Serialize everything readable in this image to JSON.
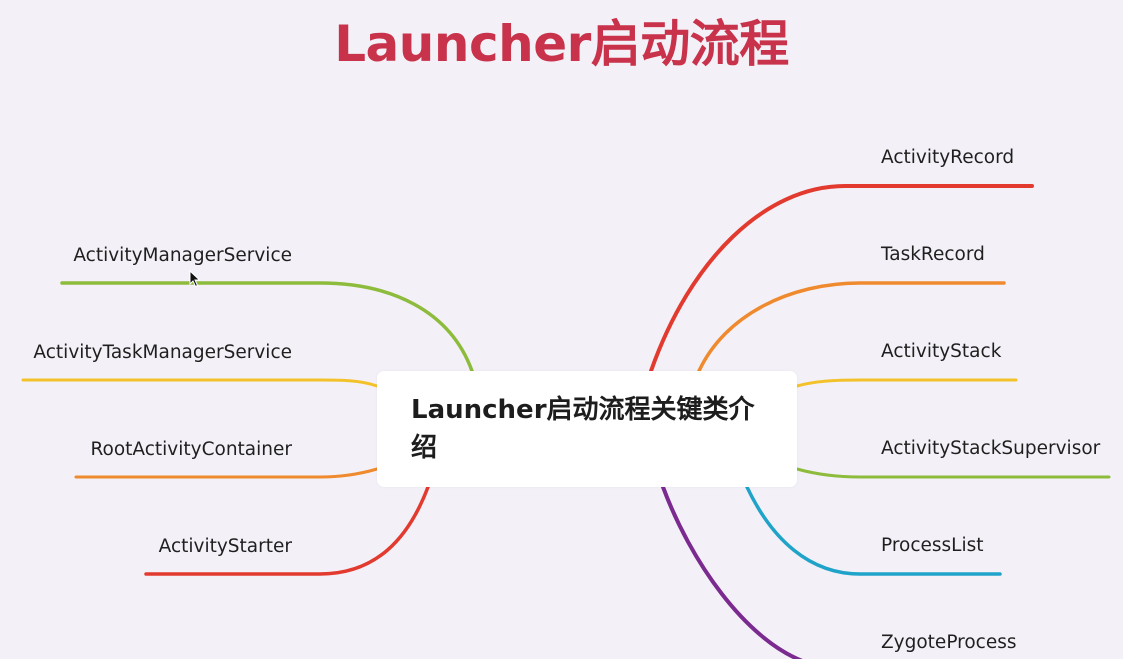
{
  "title": "Launcher启动流程",
  "center": {
    "text": "Launcher启动流程关键类介绍"
  },
  "branches": {
    "left": [
      {
        "label": "ActivityManagerService",
        "color": "#8dbb3c"
      },
      {
        "label": "ActivityTaskManagerService",
        "color": "#f3c22b"
      },
      {
        "label": "RootActivityContainer",
        "color": "#ef8a2e"
      },
      {
        "label": "ActivityStarter",
        "color": "#e23a2f"
      }
    ],
    "right": [
      {
        "label": "ActivityRecord",
        "color": "#e23a2f"
      },
      {
        "label": "TaskRecord",
        "color": "#ef8a2e"
      },
      {
        "label": "ActivityStack",
        "color": "#f3c22b"
      },
      {
        "label": "ActivityStackSupervisor",
        "color": "#8dbb3c"
      },
      {
        "label": "ProcessList",
        "color": "#1fa3c9"
      },
      {
        "label": "ZygoteProcess",
        "color": "#7b2a8f"
      }
    ]
  },
  "colors": {
    "title": "#c8324b",
    "background": "#f3f1f7",
    "center_box": "#ffffff"
  }
}
